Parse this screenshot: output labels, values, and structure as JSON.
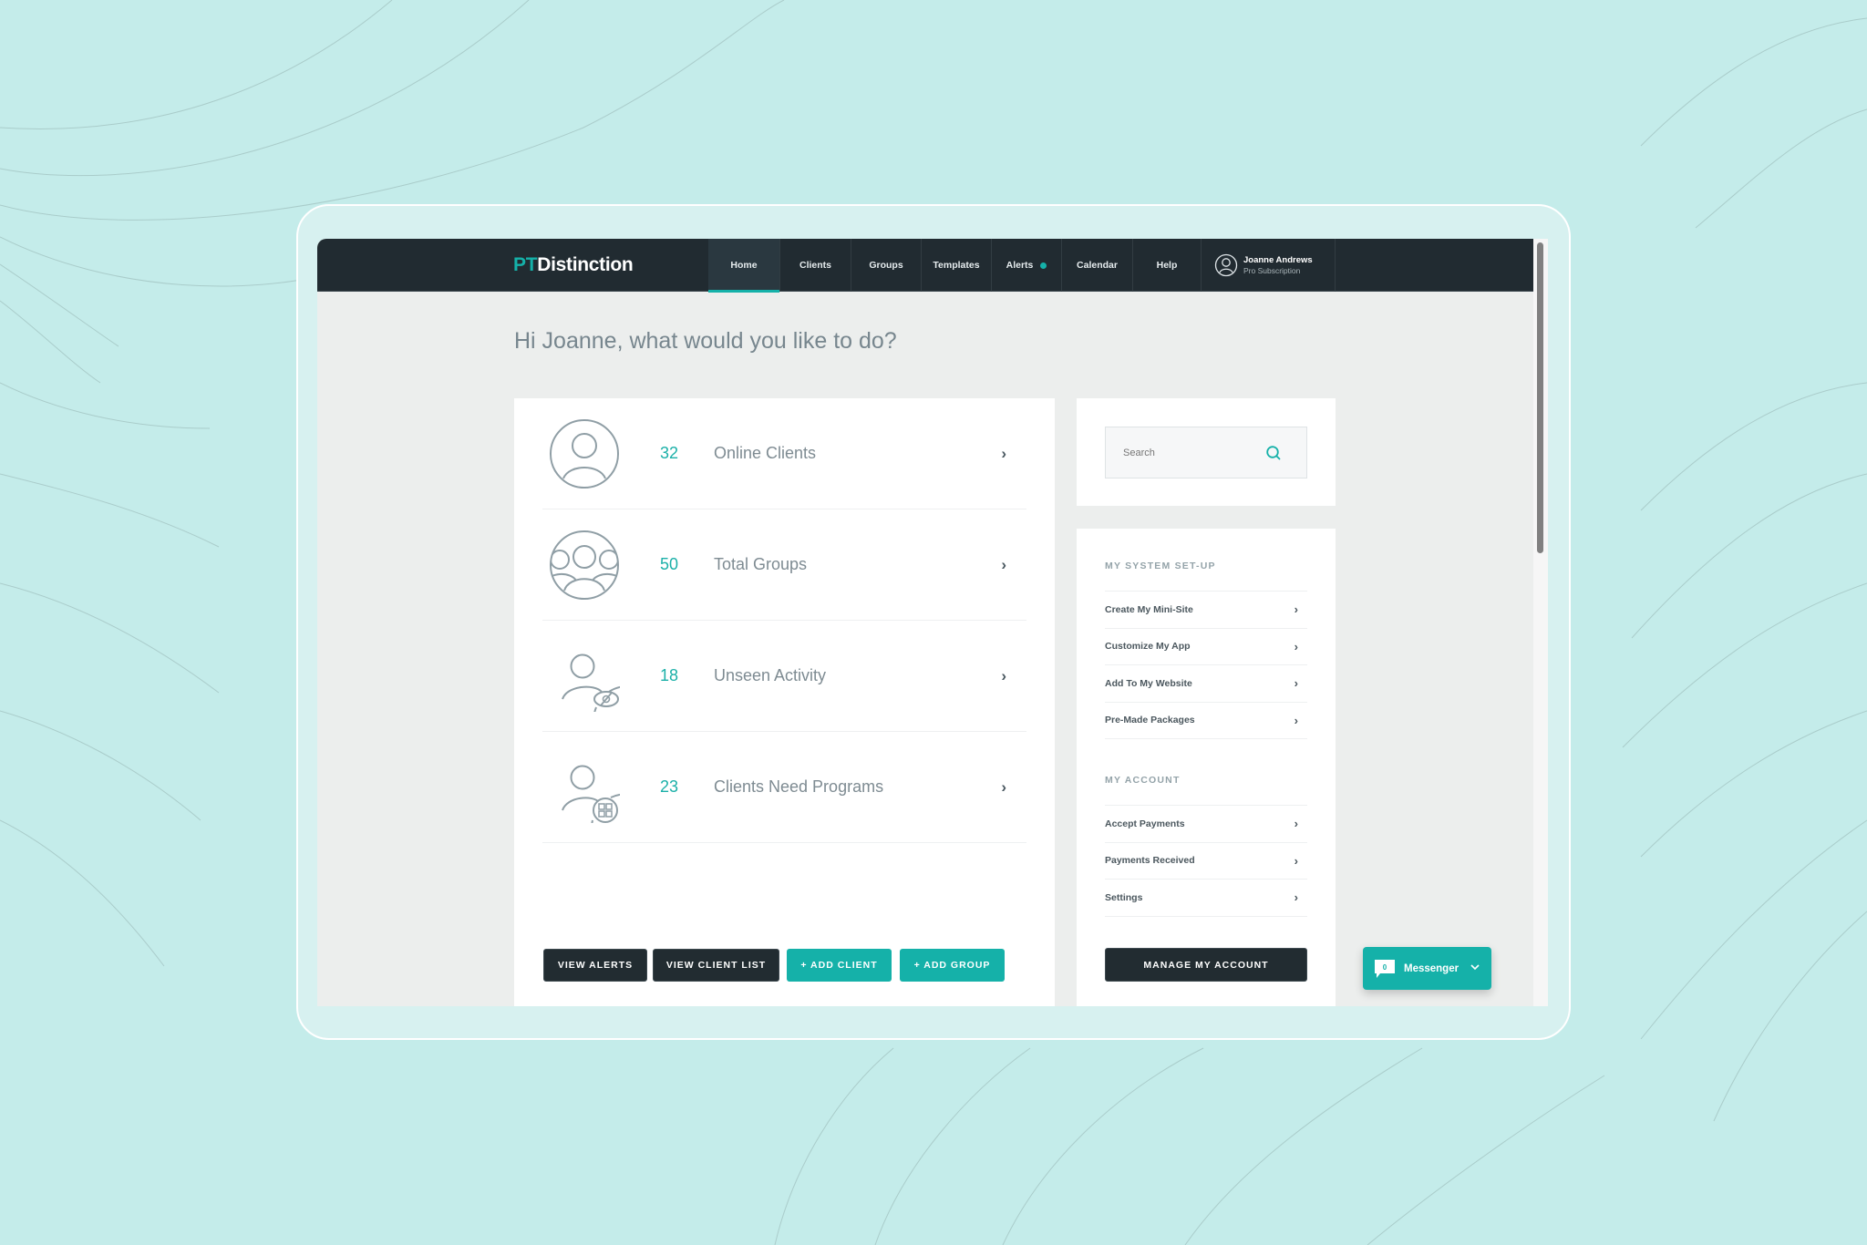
{
  "app": {
    "logo_prefix": "PT",
    "logo_suffix": "Distinction"
  },
  "nav": {
    "items": [
      {
        "label": "Home",
        "active": true
      },
      {
        "label": "Clients"
      },
      {
        "label": "Groups"
      },
      {
        "label": "Templates"
      },
      {
        "label": "Alerts",
        "has_dot": true
      },
      {
        "label": "Calendar"
      },
      {
        "label": "Help"
      }
    ],
    "user": {
      "name": "Joanne Andrews",
      "subscription": "Pro Subscription"
    }
  },
  "greeting": "Hi Joanne, what would you like to do?",
  "stats": [
    {
      "count": "32",
      "label": "Online Clients",
      "icon": "user-circle-icon"
    },
    {
      "count": "50",
      "label": "Total Groups",
      "icon": "group-circle-icon"
    },
    {
      "count": "18",
      "label": "Unseen Activity",
      "icon": "user-unseen-icon"
    },
    {
      "count": "23",
      "label": "Clients Need Programs",
      "icon": "user-programs-icon"
    }
  ],
  "chevron": "›",
  "actions": {
    "view_alerts": "VIEW ALERTS",
    "view_client_list": "VIEW CLIENT LIST",
    "add_client": "+ ADD CLIENT",
    "add_group": "+ ADD GROUP"
  },
  "search": {
    "placeholder": "Search",
    "value": ""
  },
  "sidebar": {
    "system_setup": {
      "title": "MY SYSTEM SET-UP",
      "items": [
        "Create My Mini-Site",
        "Customize My App",
        "Add To My Website",
        "Pre-Made Packages"
      ]
    },
    "account": {
      "title": "MY ACCOUNT",
      "items": [
        "Accept Payments",
        "Payments Received",
        "Settings"
      ]
    },
    "manage_button": "MANAGE MY ACCOUNT"
  },
  "messenger": {
    "label": "Messenger",
    "badge": "0"
  },
  "colors": {
    "accent": "#15b1a9",
    "navbar": "#212b31",
    "background": "#c4ecea"
  }
}
